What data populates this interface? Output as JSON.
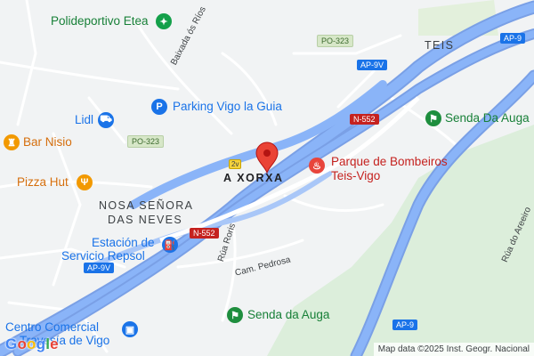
{
  "map": {
    "places": {
      "polideportivo": "Polideportivo Etea",
      "parking": "Parking Vigo la Guia",
      "lidl": "Lidl",
      "bar_nisio": "Bar Nisio",
      "pizza_hut": "Pizza Hut",
      "repsol_line1": "Estación de",
      "repsol_line2": "Servicio Repsol",
      "bombeiros_line1": "Parque de Bombeiros",
      "bombeiros_line2": "Teis-Vigo",
      "senda_top": "Senda Da Auga",
      "senda_bottom": "Senda da Auga",
      "cc_line1": "Centro Comercial",
      "cc_line2": "Travesía de Vigo"
    },
    "areas": {
      "teis": "TEIS",
      "a_xorxa": "A XORXA",
      "nosa_line1": "NOSA SEÑORA",
      "nosa_line2": "DAS NEVES"
    },
    "streets": {
      "baixada": "Baixada ós Ríos",
      "rua_roris": "Rúa Roris",
      "cam_pedrosa": "Cam. Pedrosa",
      "rua_areeiro": "Rúa do Areeiro"
    },
    "shields": {
      "po323_top": "PO-323",
      "po323_left": "PO-323",
      "ap9v_top": "AP-9V",
      "ap9v_left": "AP-9V",
      "ap9_top": "AP-9",
      "ap9_bottom": "AP-9",
      "n552_right": "N-552",
      "n552_center": "N-552",
      "n552_2v": "2v"
    },
    "google_letters": [
      "G",
      "o",
      "o",
      "g",
      "l",
      "e"
    ],
    "attribution": "Map data ©2025 Inst. Geogr. Nacional",
    "icons": {
      "polideportivo": "sports-icon",
      "parking": "parking-icon",
      "lidl": "shopping-cart-icon",
      "bar": "bar-icon",
      "pizza": "restaurant-icon",
      "fuel": "fuel-station-icon",
      "firestation": "fire-station-icon",
      "hiking": "hiking-icon",
      "mall": "shopping-bag-icon",
      "pin": "location-pin-icon"
    },
    "colors": {
      "background": "#f1f3f4",
      "highway": "#8ab4f8",
      "green_area": "#d7ecd4",
      "pin": "#ea4335"
    }
  }
}
